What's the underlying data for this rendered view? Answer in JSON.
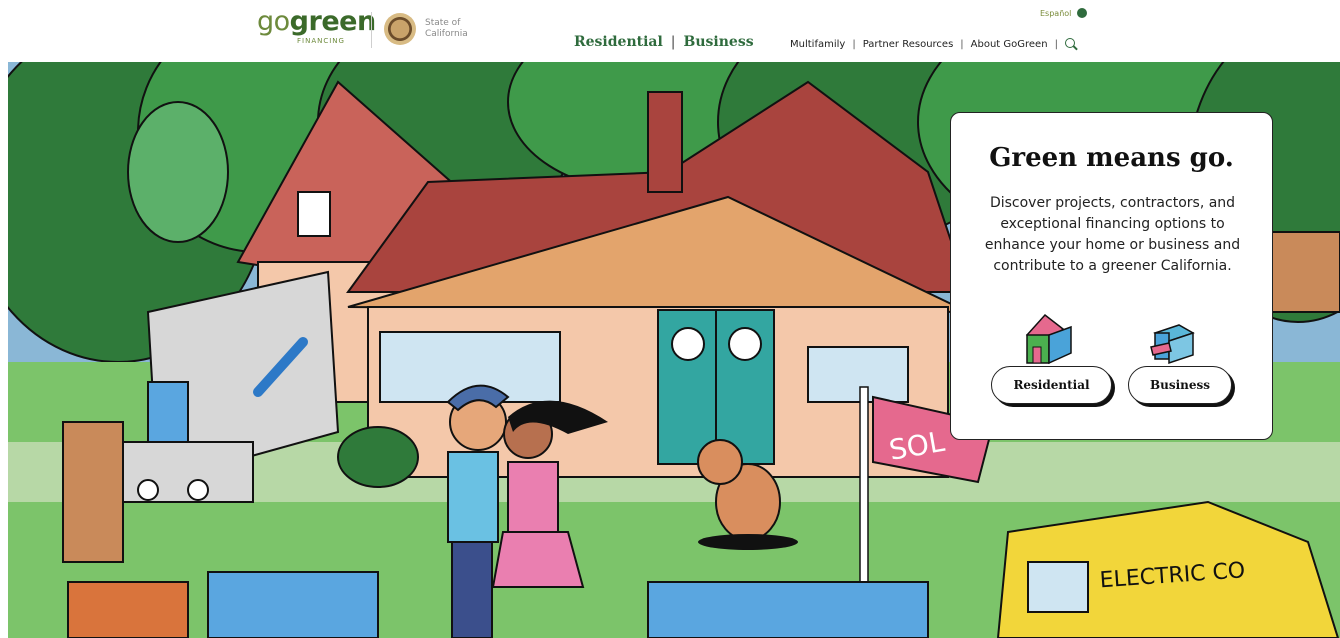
{
  "header": {
    "logo_prefix": "go",
    "logo_strong": "green",
    "logo_sub": "FINANCING",
    "state_line1": "State of",
    "state_line2": "California",
    "lang_link": "Español",
    "main_nav": [
      "Residential",
      "Business"
    ],
    "util_nav": [
      "Multifamily",
      "Partner Resources",
      "About GoGreen"
    ]
  },
  "card": {
    "title": "Green means go.",
    "body": "Discover projects, contractors, and exceptional financing options to enhance your home or business and contribute to a greener California.",
    "residential_label": "Residential",
    "business_label": "Business"
  },
  "illustration": {
    "sign_text": "SOL",
    "truck_text": "ELECTRIC CO"
  },
  "colors": {
    "brand_green": "#2f6b3d",
    "logo_green": "#6d8a3c",
    "roof_red": "#a9443e",
    "house_peach": "#f4c8aa",
    "door_teal": "#33a6a1"
  }
}
